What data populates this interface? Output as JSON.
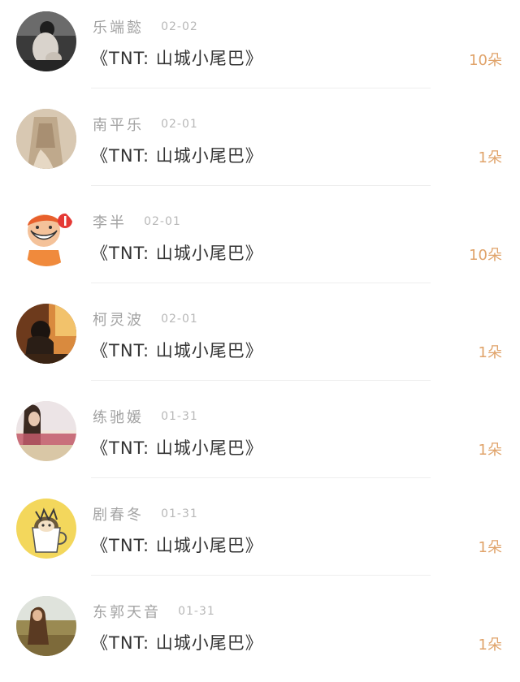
{
  "accent_color": "#e0a36a",
  "items": [
    {
      "name": "乐端懿",
      "date": "02-02",
      "title": "《TNT: 山城小尾巴》",
      "count": "10朵",
      "avatar_icon": "woman-sitting-avatar"
    },
    {
      "name": "南平乐",
      "date": "02-01",
      "title": "《TNT: 山城小尾巴》",
      "count": "1朵",
      "avatar_icon": "dress-avatar"
    },
    {
      "name": "李半",
      "date": "02-01",
      "title": "《TNT: 山城小尾巴》",
      "count": "10朵",
      "avatar_icon": "cartoon-boy-avatar"
    },
    {
      "name": "柯灵波",
      "date": "02-01",
      "title": "《TNT: 山城小尾巴》",
      "count": "1朵",
      "avatar_icon": "sitting-person-avatar"
    },
    {
      "name": "练驰媛",
      "date": "01-31",
      "title": "《TNT: 山城小尾巴》",
      "count": "1朵",
      "avatar_icon": "girl-sky-avatar"
    },
    {
      "name": "剧春冬",
      "date": "01-31",
      "title": "《TNT: 山城小尾巴》",
      "count": "1朵",
      "avatar_icon": "cartoon-cup-avatar"
    },
    {
      "name": "东郭天音",
      "date": "01-31",
      "title": "《TNT: 山城小尾巴》",
      "count": "1朵",
      "avatar_icon": "girl-field-avatar"
    }
  ]
}
